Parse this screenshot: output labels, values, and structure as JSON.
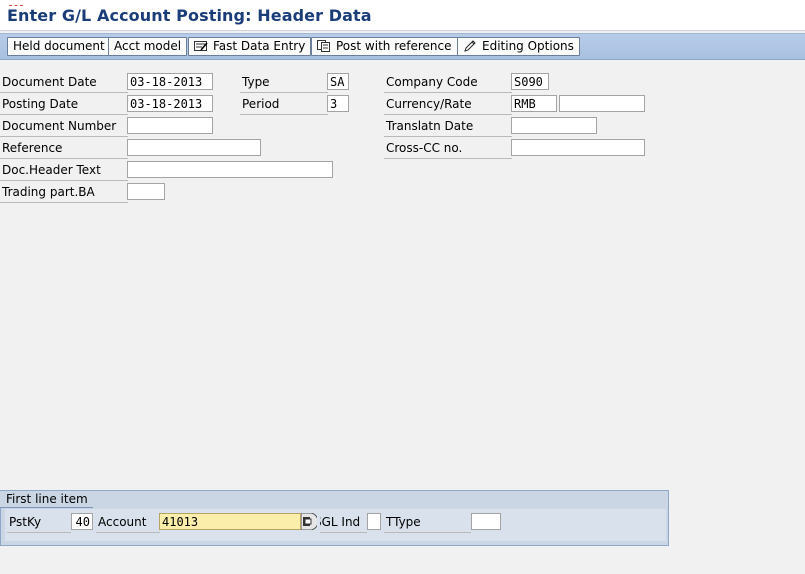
{
  "title": "Enter G/L Account Posting: Header Data",
  "toolbar": {
    "held_document": "Held document",
    "acct_model": "Acct model",
    "fast_data_entry": "Fast Data Entry",
    "post_with_reference": "Post with reference",
    "editing_options": "Editing Options"
  },
  "header": {
    "document_date": {
      "label": "Document Date",
      "value": "03-18-2013"
    },
    "posting_date": {
      "label": "Posting Date",
      "value": "03-18-2013"
    },
    "document_number": {
      "label": "Document Number",
      "value": ""
    },
    "reference": {
      "label": "Reference",
      "value": ""
    },
    "doc_header_text": {
      "label": "Doc.Header Text",
      "value": ""
    },
    "trading_part_ba": {
      "label": "Trading part.BA",
      "value": ""
    },
    "type": {
      "label": "Type",
      "value": "SA"
    },
    "period": {
      "label": "Period",
      "value": "3"
    },
    "company_code": {
      "label": "Company Code",
      "value": "S090"
    },
    "currency_rate": {
      "label": "Currency/Rate",
      "currency": "RMB",
      "rate": ""
    },
    "translatn_date": {
      "label": "Translatn Date",
      "value": ""
    },
    "cross_cc_no": {
      "label": "Cross-CC no.",
      "value": ""
    }
  },
  "first_line_item": {
    "tab_label": "First line item",
    "pstky_label": "PstKy",
    "pstky_value": "40",
    "account_label": "Account",
    "account_value": "41013",
    "sgl_ind_label": "SGL Ind",
    "sgl_ind_value": "",
    "ttype_label": "TType",
    "ttype_value": ""
  },
  "colors": {
    "title": "#1a3d7a",
    "toolbar_bg": "#b0c6e4",
    "field_bg": "#ffffff",
    "focus_field_bg": "#fbeeaa",
    "panel_bg": "#cbd6e4"
  },
  "icons": [
    "fast-data-entry-icon",
    "post-with-reference-icon",
    "pencil-icon",
    "match-code-icon"
  ]
}
